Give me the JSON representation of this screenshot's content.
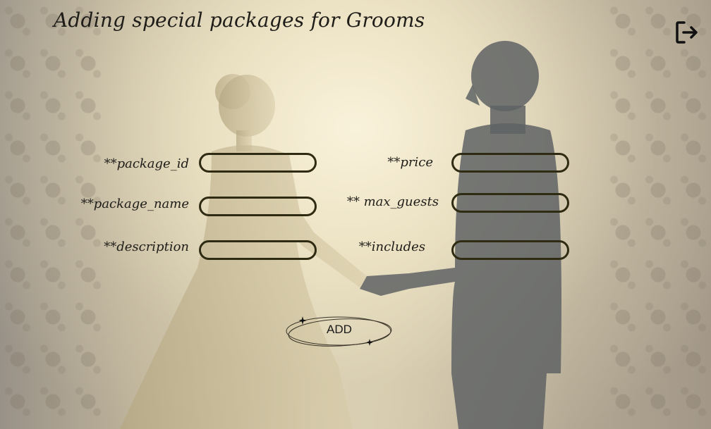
{
  "page": {
    "title": "Adding special packages for Grooms"
  },
  "header": {
    "logout_icon": "logout-arrow-icon"
  },
  "form": {
    "fields": [
      {
        "label": "**package_id",
        "value": "",
        "placeholder": ""
      },
      {
        "label": "**package_name",
        "value": "",
        "placeholder": ""
      },
      {
        "label": "**description",
        "value": "",
        "placeholder": ""
      },
      {
        "label": "**price",
        "value": "",
        "placeholder": ""
      },
      {
        "label": "** max_guests",
        "value": "",
        "placeholder": ""
      },
      {
        "label": "**includes",
        "value": "",
        "placeholder": ""
      }
    ],
    "add_label": "ADD"
  },
  "colors": {
    "field_border": "#2f2a12",
    "text": "#1f1d19",
    "background_light": "#ece2c3"
  }
}
